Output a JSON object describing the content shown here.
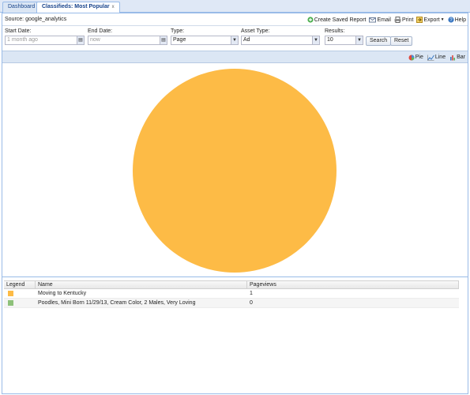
{
  "tabs": [
    {
      "label": "Dashboard"
    },
    {
      "label": "Classifieds: Most Popular",
      "close": "x"
    }
  ],
  "source": {
    "label": "Source: google_analytics"
  },
  "toolbar": {
    "create_saved_report": "Create Saved Report",
    "email": "Email",
    "print": "Print",
    "export": "Export",
    "help": "Help"
  },
  "filters": {
    "start_date": {
      "label": "Start Date:",
      "value": "1 month ago"
    },
    "end_date": {
      "label": "End Date:",
      "value": "now"
    },
    "type": {
      "label": "Type:",
      "value": "Page"
    },
    "asset_type": {
      "label": "Asset Type:",
      "value": "Ad"
    },
    "results": {
      "label": "Results:",
      "value": "10"
    },
    "search_label": "Search",
    "reset_label": "Reset"
  },
  "chart_types": {
    "pie": "Pie",
    "line": "Line",
    "bar": "Bar"
  },
  "chart_data": {
    "type": "pie",
    "categories": [
      "Moving to Kentucky",
      "Poodles, Mini Born 11/29/13, Cream Color, 2 Males, Very Loving"
    ],
    "values": [
      1,
      0
    ],
    "colors": [
      "#fdbb46",
      "#8ec17a"
    ]
  },
  "grid": {
    "headers": [
      "Legend",
      "Name",
      "Pageviews"
    ],
    "rows": [
      {
        "name": "Moving to Kentucky",
        "pageviews": "1",
        "color": "#fdbb46"
      },
      {
        "name": "Poodles, Mini Born 11/29/13, Cream Color, 2 Males, Very Loving",
        "pageviews": "0",
        "color": "#8ec17a"
      }
    ]
  }
}
